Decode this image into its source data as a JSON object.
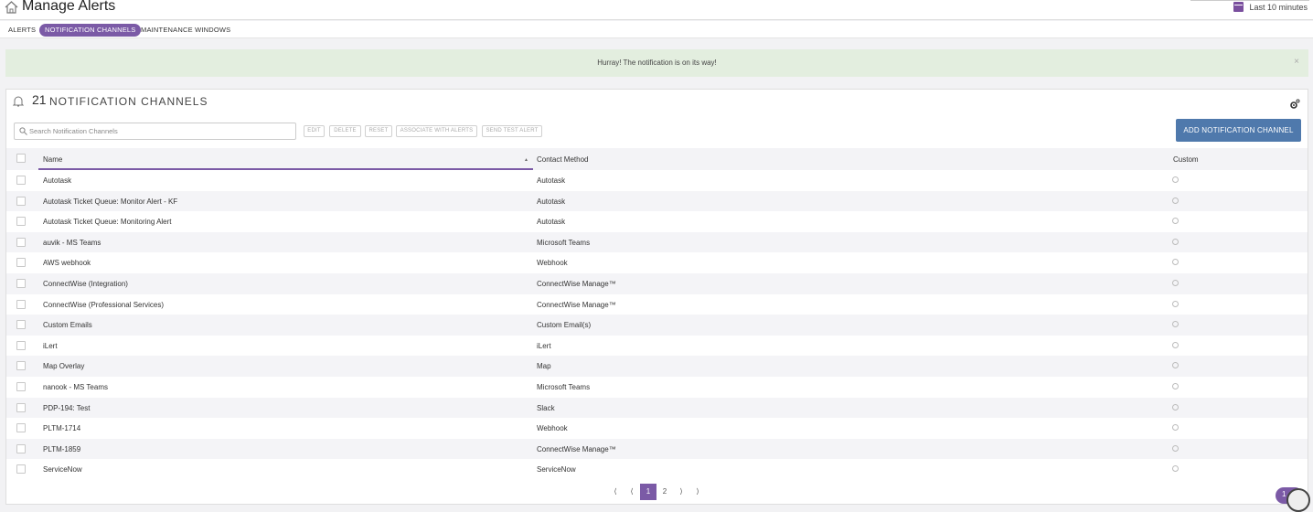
{
  "header": {
    "title": "Manage Alerts",
    "timerange": "Last 10 minutes"
  },
  "tabs": [
    {
      "label": "ALERTS",
      "active": false
    },
    {
      "label": "NOTIFICATION CHANNELS",
      "active": true
    },
    {
      "label": "MAINTENANCE WINDOWS",
      "active": false
    }
  ],
  "banner": {
    "message": "Hurray! The notification is on its way!",
    "close": "×",
    "color": "#e3eedf"
  },
  "panel": {
    "count": "21",
    "title": "NOTIFICATION CHANNELS",
    "search_placeholder": "Search Notification Channels",
    "toolbar": {
      "edit": "EDIT",
      "delete": "DELETE",
      "reset": "RESET",
      "associate": "ASSOCIATE WITH ALERTS",
      "send_test": "SEND TEST ALERT"
    },
    "add_button": "ADD NOTIFICATION CHANNEL"
  },
  "table": {
    "columns": {
      "name": "Name",
      "contact": "Contact Method",
      "custom": "Custom"
    },
    "sort": "name ascending",
    "rows": [
      {
        "name": "Autotask",
        "contact": "Autotask"
      },
      {
        "name": "Autotask Ticket Queue: Monitor Alert - KF",
        "contact": "Autotask"
      },
      {
        "name": "Autotask Ticket Queue: Monitoring Alert",
        "contact": "Autotask"
      },
      {
        "name": "auvik - MS Teams",
        "contact": "Microsoft Teams"
      },
      {
        "name": "AWS webhook",
        "contact": "Webhook"
      },
      {
        "name": "ConnectWise (Integration)",
        "contact": "ConnectWise Manage™"
      },
      {
        "name": "ConnectWise (Professional Services)",
        "contact": "ConnectWise Manage™"
      },
      {
        "name": "Custom Emails",
        "contact": "Custom Email(s)"
      },
      {
        "name": "iLert",
        "contact": "iLert"
      },
      {
        "name": "Map Overlay",
        "contact": "Map"
      },
      {
        "name": "nanook - MS Teams",
        "contact": "Microsoft Teams"
      },
      {
        "name": "PDP-194: Test",
        "contact": "Slack"
      },
      {
        "name": "PLTM-1714",
        "contact": "Webhook"
      },
      {
        "name": "PLTM-1859",
        "contact": "ConnectWise Manage™"
      },
      {
        "name": "ServiceNow",
        "contact": "ServiceNow"
      }
    ]
  },
  "pagination": {
    "first": "⟨",
    "prev": "⟨",
    "pages": [
      "1",
      "2"
    ],
    "current": "1",
    "next": "⟩",
    "last": "⟩"
  },
  "help_badge": "1",
  "colors": {
    "accent": "#7b5aa6",
    "primary_button": "#4f79ac"
  }
}
